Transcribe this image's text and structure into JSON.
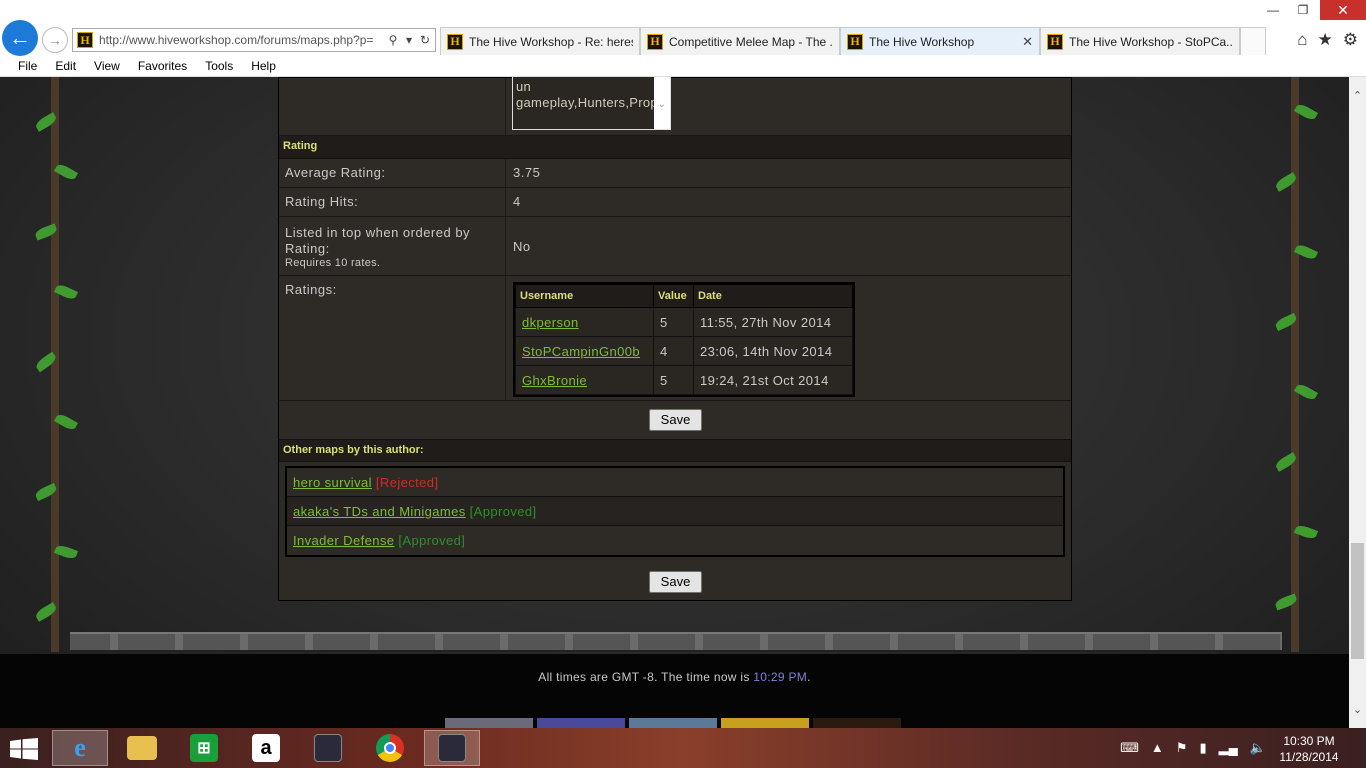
{
  "browser": {
    "url": "http://www.hiveworkshop.com/forums/maps.php?p=",
    "favicon_letter": "H",
    "tabs": [
      {
        "label": "The Hive Workshop - Re: heres..."
      },
      {
        "label": "Competitive Melee Map - The ..."
      },
      {
        "label": "The Hive Workshop",
        "active": true
      },
      {
        "label": "The Hive Workshop - StoPCa..."
      }
    ],
    "menu": [
      "File",
      "Edit",
      "View",
      "Favorites",
      "Tools",
      "Help"
    ]
  },
  "tags_box": {
    "text": "un gameplay,Hunters,Props,akaka"
  },
  "rating_section": {
    "header": "Rating",
    "average_label": "Average Rating:",
    "average_value": "3.75",
    "hits_label": "Rating Hits:",
    "hits_value": "4",
    "listed_label": "Listed in top when ordered by Rating:",
    "listed_note": "Requires 10 rates.",
    "listed_value": "No",
    "ratings_label": "Ratings:",
    "table_headers": {
      "username": "Username",
      "value": "Value",
      "date": "Date"
    },
    "ratings": [
      {
        "username": "dkperson",
        "value": "5",
        "date": "11:55, 27th Nov 2014"
      },
      {
        "username": "StoPCampinGn00b",
        "value": "4",
        "date": "23:06, 14th Nov 2014"
      },
      {
        "username": "GhxBronie",
        "value": "5",
        "date": "19:24, 21st Oct 2014"
      }
    ]
  },
  "save_label": "Save",
  "other_maps": {
    "header": "Other maps by this author:",
    "items": [
      {
        "name": "hero survival",
        "status": "[Rejected]",
        "status_color": "#d12a24"
      },
      {
        "name": "akaka's TDs and Minigames",
        "status": "[Approved]",
        "status_color": "#2f8f2a"
      },
      {
        "name": "Invader Defense",
        "status": "[Approved]",
        "status_color": "#2f8f2a"
      }
    ]
  },
  "footer": {
    "text_before": "All times are GMT -8. The time now is ",
    "time": "10:29 PM",
    "text_after": "."
  },
  "taskbar": {
    "apps": [
      "internet-explorer",
      "file-explorer",
      "store",
      "amazon",
      "warcraft",
      "chrome",
      "warcraft-2"
    ],
    "clock_time": "10:30 PM",
    "clock_date": "11/28/2014"
  }
}
